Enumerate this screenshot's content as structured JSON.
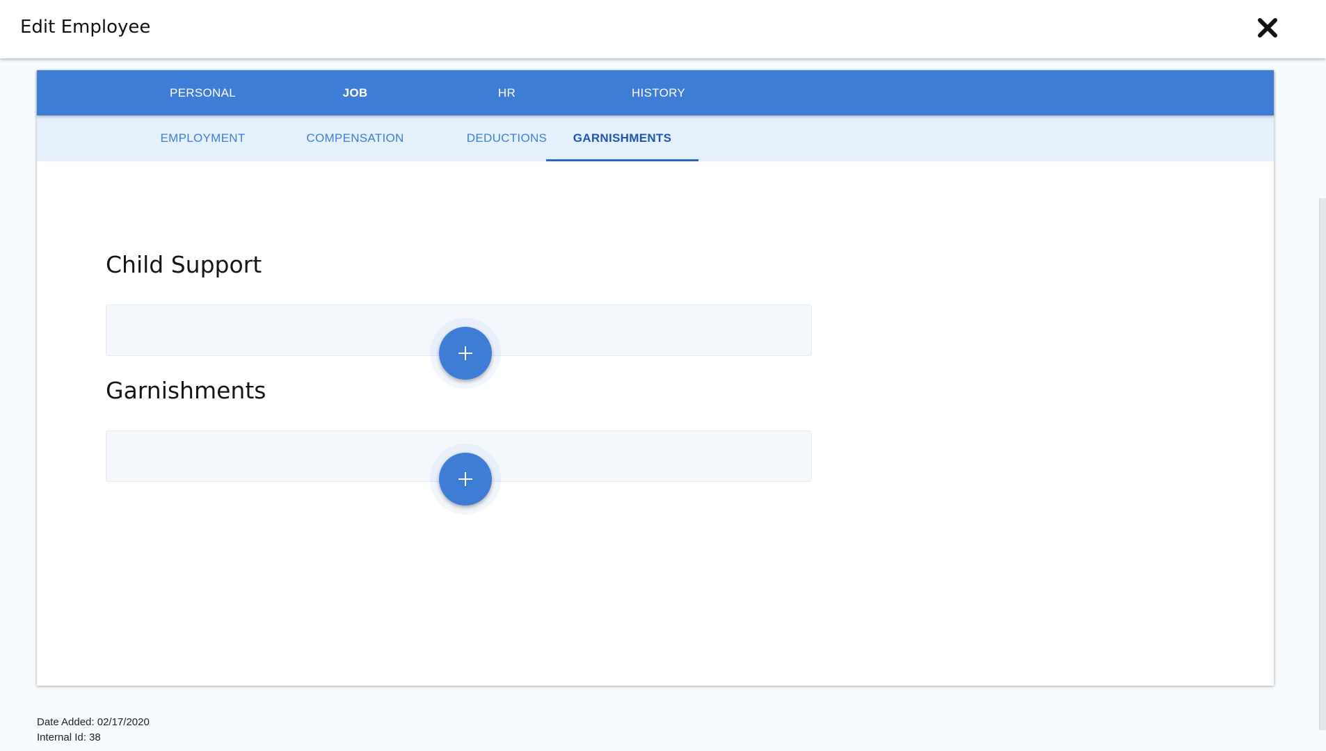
{
  "header": {
    "title": "Edit Employee",
    "close_icon": "close-icon"
  },
  "primary_tabs": [
    {
      "label": "PERSONAL",
      "active": false
    },
    {
      "label": "JOB",
      "active": true
    },
    {
      "label": "HR",
      "active": false
    },
    {
      "label": "HISTORY",
      "active": false
    }
  ],
  "secondary_tabs": [
    {
      "label": "EMPLOYMENT",
      "active": false
    },
    {
      "label": "COMPENSATION",
      "active": false
    },
    {
      "label": "DEDUCTIONS",
      "active": false
    },
    {
      "label": "GARNISHMENTS",
      "active": true
    }
  ],
  "sections": [
    {
      "title": "Child Support",
      "add_icon": "plus-icon"
    },
    {
      "title": "Garnishments",
      "add_icon": "plus-icon"
    }
  ],
  "footer": {
    "date_added": "Date Added: 02/17/2020",
    "internal_id": "Internal Id: 38"
  },
  "colors": {
    "primary": "#3d7dd6",
    "secondary_bg": "#e4f0fb",
    "active_tab_text": "#1f55b0"
  }
}
